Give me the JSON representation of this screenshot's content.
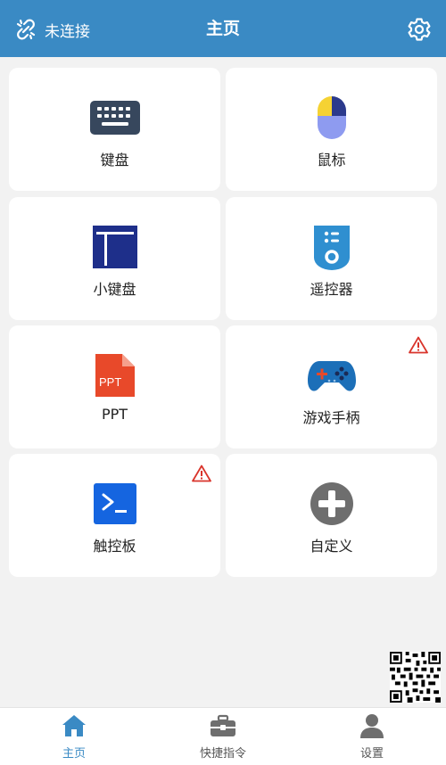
{
  "header": {
    "connection_status": "未连接",
    "title": "主页",
    "settings_icon": "gear-icon",
    "background": "#3a8ac4"
  },
  "cards": [
    {
      "label": "键盘",
      "icon": "keyboard-icon",
      "warning": false
    },
    {
      "label": "鼠标",
      "icon": "mouse-icon",
      "warning": false
    },
    {
      "label": "小键盘",
      "icon": "numpad-icon",
      "warning": false
    },
    {
      "label": "遥控器",
      "icon": "remote-icon",
      "warning": false
    },
    {
      "label": "PPT",
      "icon": "ppt-icon",
      "icon_text": "PPT",
      "warning": false
    },
    {
      "label": "游戏手柄",
      "icon": "gamepad-icon",
      "warning": true
    },
    {
      "label": "触控板",
      "icon": "terminal-icon",
      "warning": true
    },
    {
      "label": "自定义",
      "icon": "add-icon",
      "warning": false
    }
  ],
  "warning_icon": "warning-icon",
  "qr_icon": "qr-code-icon",
  "tabbar": {
    "tabs": [
      {
        "label": "主页",
        "icon": "home-icon",
        "active": true
      },
      {
        "label": "快捷指令",
        "icon": "toolbox-icon",
        "active": false
      },
      {
        "label": "设置",
        "icon": "user-icon",
        "active": false
      }
    ],
    "active_color": "#3a8ac4"
  }
}
